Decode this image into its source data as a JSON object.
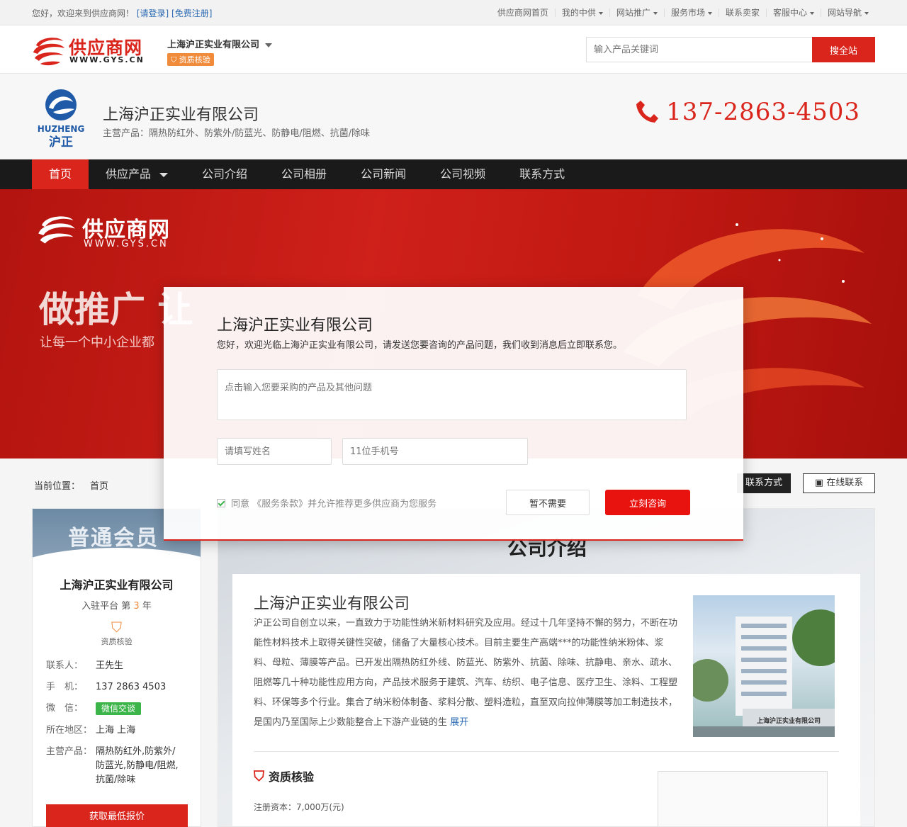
{
  "topbar": {
    "greeting": "您好，欢迎来到供应商网！",
    "login": "[请登录]",
    "register": "[免费注册]",
    "nav": [
      "供应商网首页",
      "我的中供",
      "网站推广",
      "服务市场",
      "联系卖家",
      "客服中心",
      "网站导航"
    ]
  },
  "header": {
    "brand": "供应商网",
    "brand_url": "WWW.GYS.CN",
    "company": "上海沪正实业有限公司",
    "verify_badge": "资质核验",
    "search_placeholder": "输入产品关键词",
    "search_button": "搜全站"
  },
  "company": {
    "logo_en": "HUZHENG",
    "logo_cn": "沪正",
    "name": "上海沪正实业有限公司",
    "products": "主营产品：隔热防红外、防紫外/防蓝光、防静电/阻燃、抗菌/除味",
    "phone": "137-2863-4503"
  },
  "nav": [
    "首页",
    "供应产品",
    "公司介绍",
    "公司相册",
    "公司新闻",
    "公司视频",
    "联系方式"
  ],
  "hero": {
    "brand": "供应商网",
    "brand_url": "WWW.GYS.CN",
    "slogan": "做推广 让",
    "sub": "让每一个中小企业都"
  },
  "breadcrumb": {
    "label": "当前位置：",
    "current": "首页"
  },
  "actions": {
    "contact": "联系方式",
    "online": "在线联系"
  },
  "sidebar": {
    "member": "普通会员",
    "company": "上海沪正实业有限公司",
    "years_prefix": "入驻平台 第",
    "years": "3",
    "years_suffix": "年",
    "verify": "资质核验",
    "contact_label": "联系人：",
    "contact": "王先生",
    "phone_label": "手　机：",
    "phone": "137 2863 4503",
    "wechat_label": "微　信：",
    "wechat_btn": "微信交谈",
    "region_label": "所在地区：",
    "region": "上海 上海",
    "products_label": "主营产品：",
    "products": "隔热防红外,防紫外/防蓝光,防静电/阻燃,抗菌/除味",
    "quote_btn": "获取最低报价"
  },
  "main": {
    "section_title": "公司介绍",
    "company": "上海沪正实业有限公司",
    "desc": "沪正公司自创立以来，一直致力于功能性纳米新材料研究及应用。经过十几年坚持不懈的努力，不断在功能性材料技术上取得关键性突破，储备了大量核心技术。目前主要生产高端***的功能性纳米粉体、浆料、母粒、薄膜等产品。已开发出隔热防红外线、防蓝光、防紫外、抗菌、除味、抗静电、亲水、疏水、阻燃等几十种功能性应用方向，产品技术服务于建筑、汽车、纺织、电子信息、医疗卫生、涂料、工程塑料、环保等多个行业。集合了纳米粉体制备、浆料分散、塑料造粒，直至双向拉伸薄膜等加工制造技术，是国内乃至国际上少数能整合上下游产业链的生",
    "more": "展开",
    "photo_sign": "上海沪正实业有限公司",
    "qual_title": "资质核验",
    "reg_capital": "注册资本：7,000万(元)"
  },
  "modal": {
    "title": "上海沪正实业有限公司",
    "subtitle": "您好，欢迎光临上海沪正实业有限公司，请发送您要咨询的产品问题，我们收到消息后立即联系您。",
    "question_placeholder": "点击输入您要采购的产品及其他问题",
    "name_placeholder": "请填写姓名",
    "phone_placeholder": "11位手机号",
    "agree": "同意 《服务条款》并允许推荐更多供应商为您服务",
    "btn_no": "暂不需要",
    "btn_yes": "立刻咨询"
  },
  "colors": {
    "brand_red": "#d9251c",
    "nav_bg": "#1a1a1a",
    "orange": "#f08b3c",
    "link_blue": "#2b6bb3"
  }
}
